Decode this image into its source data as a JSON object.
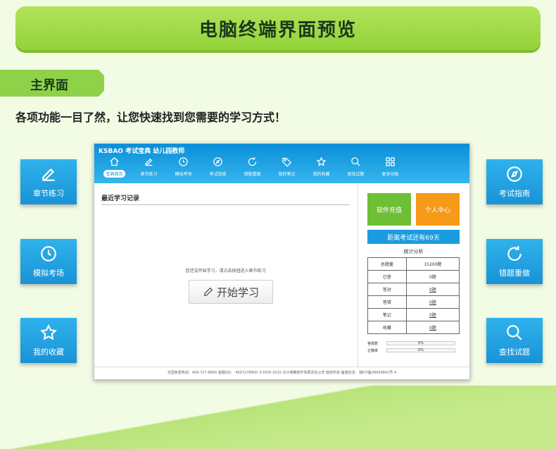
{
  "banner": {
    "title": "电脑终端界面预览"
  },
  "section": {
    "tag": "主界面",
    "subtitle": "各项功能一目了然，让您快速找到您需要的学习方式！"
  },
  "side_left": [
    {
      "label": "章节练习",
      "icon": "edit-icon"
    },
    {
      "label": "模拟考场",
      "icon": "clock-icon"
    },
    {
      "label": "我的收藏",
      "icon": "star-icon"
    }
  ],
  "side_right": [
    {
      "label": "考试指南",
      "icon": "compass-icon"
    },
    {
      "label": "错题重做",
      "icon": "redo-icon"
    },
    {
      "label": "查找试题",
      "icon": "search-icon"
    }
  ],
  "app": {
    "logo": "KSBAO",
    "logo_sub": "考试宝典",
    "course": "幼儿园教师",
    "nav": [
      {
        "label": "宝典首页",
        "icon": "home-icon",
        "active": true
      },
      {
        "label": "章节练习",
        "icon": "edit-icon"
      },
      {
        "label": "模拟考场",
        "icon": "clock-icon"
      },
      {
        "label": "考试指南",
        "icon": "compass-icon"
      },
      {
        "label": "错题重做",
        "icon": "redo-icon"
      },
      {
        "label": "我的笔记",
        "icon": "tag-icon"
      },
      {
        "label": "我的收藏",
        "icon": "star-icon"
      },
      {
        "label": "查找试题",
        "icon": "search-icon"
      },
      {
        "label": "更多功能",
        "icon": "grid-icon"
      }
    ],
    "recent_title": "最近学习记录",
    "empty_msg": "您还没开始学习，请点击按钮进入章节练习",
    "start_button": "开始学习",
    "charge_button": "软件充值",
    "personal_button": "个人中心",
    "countdown": "距离考试还有69天",
    "stats_title": "统计分析",
    "stats": [
      {
        "label": "总题量",
        "value": "15200题",
        "link": false
      },
      {
        "label": "已答",
        "value": "0题",
        "link": false
      },
      {
        "label": "答对",
        "value": "0题",
        "link": true
      },
      {
        "label": "答错",
        "value": "0题",
        "link": true
      },
      {
        "label": "笔记",
        "value": "0题",
        "link": true
      },
      {
        "label": "收藏",
        "value": "0题",
        "link": true
      }
    ],
    "progress": [
      {
        "label": "答题数",
        "value": "0%"
      },
      {
        "label": "正确率",
        "value": "0%"
      }
    ],
    "footer": "全国免费热线：400-727-8800  客服QQ： 4007278800  ©2005-2015  长沙英腾软件有限责任公司 版权所有  备案信息：湘ICP备09009842号-4"
  }
}
